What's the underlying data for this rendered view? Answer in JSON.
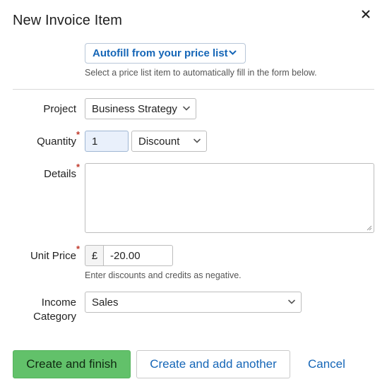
{
  "dialog": {
    "title": "New Invoice Item",
    "close_icon": "close-icon"
  },
  "autofill": {
    "button_label": "Autofill from your price list",
    "help_text": "Select a price list item to automatically fill in the form below."
  },
  "form": {
    "project": {
      "label": "Project",
      "selected": "Business Strategy"
    },
    "quantity": {
      "label": "Quantity",
      "required_mark": "*",
      "value": "1",
      "type_selected": "Discount"
    },
    "details": {
      "label": "Details",
      "required_mark": "*",
      "value": ""
    },
    "unit_price": {
      "label": "Unit Price",
      "required_mark": "*",
      "currency_symbol": "£",
      "value": "-20.00",
      "help_text": "Enter discounts and credits as negative."
    },
    "income_category": {
      "label_line1": "Income",
      "label_line2": "Category",
      "selected": "Sales"
    }
  },
  "actions": {
    "create_finish": "Create and finish",
    "create_another": "Create and add another",
    "cancel": "Cancel"
  },
  "colors": {
    "primary_green": "#62c16a",
    "link_blue": "#1566b7",
    "required_red": "#c0392b"
  }
}
